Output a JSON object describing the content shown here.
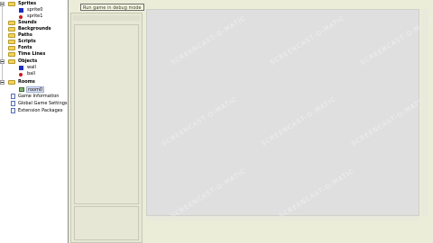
{
  "tree": {
    "items": [
      {
        "id": "sprites",
        "label": "Sprites",
        "type": "folder",
        "expanded": true,
        "bold": true
      },
      {
        "id": "sprite0",
        "label": "sprite0",
        "type": "sprite-blue"
      },
      {
        "id": "sprite1",
        "label": "sprite1",
        "type": "sprite-red"
      },
      {
        "id": "sounds",
        "label": "Sounds",
        "type": "folder",
        "bold": true
      },
      {
        "id": "backgrounds",
        "label": "Backgrounds",
        "type": "folder",
        "bold": true
      },
      {
        "id": "paths",
        "label": "Paths",
        "type": "folder",
        "bold": true
      },
      {
        "id": "scripts",
        "label": "Scripts",
        "type": "folder",
        "bold": true
      },
      {
        "id": "fonts",
        "label": "Fonts",
        "type": "folder",
        "bold": true
      },
      {
        "id": "timelines",
        "label": "Time Lines",
        "type": "folder",
        "bold": true
      },
      {
        "id": "objects",
        "label": "Objects",
        "type": "folder",
        "expanded": true,
        "bold": true
      },
      {
        "id": "wall",
        "label": "wall",
        "type": "sprite-blue"
      },
      {
        "id": "ball",
        "label": "ball",
        "type": "sprite-red"
      },
      {
        "id": "rooms",
        "label": "Rooms",
        "type": "folder",
        "expanded": true,
        "bold": true
      },
      {
        "id": "room0",
        "label": "room0",
        "type": "room"
      },
      {
        "id": "game-information",
        "label": "Game Information",
        "type": "doc"
      },
      {
        "id": "global-game-settings",
        "label": "Global Game Settings",
        "type": "doc"
      },
      {
        "id": "extension-packages",
        "label": "Extension Packages",
        "type": "doc"
      }
    ]
  },
  "tooltip": {
    "text": "Run game in debug mode"
  },
  "watermark": {
    "text": "SCREENCAST-O-MATIC"
  },
  "colors": {
    "canvas": "#dfdfdf",
    "sprite": "#1d2bc0",
    "object_red": "#d01919",
    "folder": "#f2d35b"
  }
}
